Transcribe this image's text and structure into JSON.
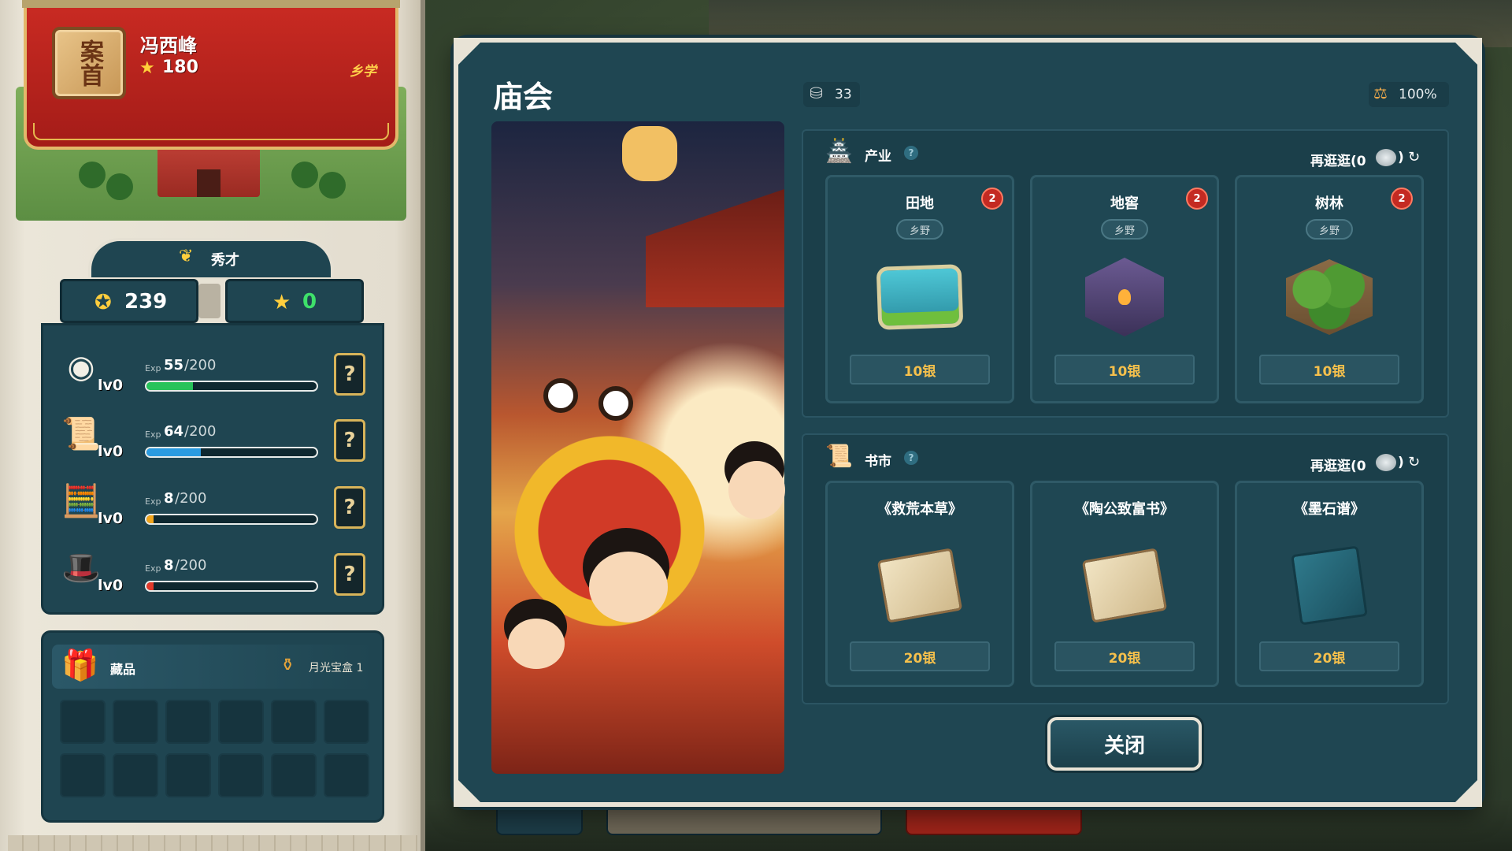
{
  "player": {
    "rank_plaque": "案首",
    "name": "冯西峰",
    "score": "180",
    "school": "乡学"
  },
  "title_rank": "秀才",
  "stats": {
    "left_value": "239",
    "right_value": "0"
  },
  "skills": [
    {
      "icon": "eyeball-icon",
      "level": "lv0",
      "exp_label": "Exp",
      "exp": "55",
      "max": "/200",
      "progress": 0.275,
      "color": "#27c35a"
    },
    {
      "icon": "scroll-icon",
      "level": "lv0",
      "exp_label": "Exp",
      "exp": "64",
      "max": "/200",
      "progress": 0.32,
      "color": "#2a9be0"
    },
    {
      "icon": "abacus-icon",
      "level": "lv0",
      "exp_label": "Exp",
      "exp": "8",
      "max": "/200",
      "progress": 0.04,
      "color": "#f2a51c"
    },
    {
      "icon": "official-hat-icon",
      "level": "lv0",
      "exp_label": "Exp",
      "exp": "8",
      "max": "/200",
      "progress": 0.04,
      "color": "#e23a2b"
    }
  ],
  "skill_help_label": "?",
  "collection": {
    "title": "藏品",
    "treasure": "月光宝盒 1"
  },
  "dialog": {
    "title": "庙会",
    "silver": "33",
    "rate": "100%",
    "close_label": "关闭",
    "help_label": "?",
    "industry": {
      "title": "产业",
      "refresh": "再逛逛(0",
      "refresh_end": ")",
      "cards": [
        {
          "name": "田地",
          "badge": "2",
          "tag": "乡野",
          "price": "10银",
          "art": "field"
        },
        {
          "name": "地窖",
          "badge": "2",
          "tag": "乡野",
          "price": "10银",
          "art": "cellar"
        },
        {
          "name": "树林",
          "badge": "2",
          "tag": "乡野",
          "price": "10银",
          "art": "forest"
        }
      ]
    },
    "books": {
      "title": "书市",
      "refresh": "再逛逛(0",
      "refresh_end": ")",
      "cards": [
        {
          "name": "《救荒本草》",
          "price": "20银",
          "art": "scroll"
        },
        {
          "name": "《陶公致富书》",
          "price": "20银",
          "art": "scroll"
        },
        {
          "name": "《墨石谱》",
          "price": "20银",
          "art": "book"
        }
      ]
    }
  },
  "colors": {
    "panel": "#1f4652",
    "accent_gold": "#f5c04c",
    "banner_red": "#c82a22"
  }
}
